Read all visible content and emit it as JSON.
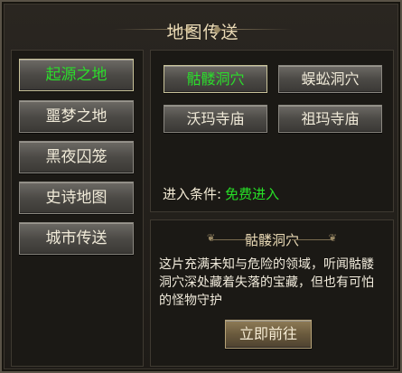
{
  "window": {
    "title": "地图传送"
  },
  "sidebar": {
    "items": [
      {
        "label": "起源之地",
        "active": true
      },
      {
        "label": "噩梦之地",
        "active": false
      },
      {
        "label": "黑夜囚笼",
        "active": false
      },
      {
        "label": "史诗地图",
        "active": false
      },
      {
        "label": "城市传送",
        "active": false
      }
    ]
  },
  "destinations": [
    {
      "label": "骷髅洞穴",
      "selected": true
    },
    {
      "label": "蜈蚣洞穴",
      "selected": false
    },
    {
      "label": "沃玛寺庙",
      "selected": false
    },
    {
      "label": "祖玛寺庙",
      "selected": false
    }
  ],
  "requirement": {
    "label": "进入条件:",
    "value": "免费进入"
  },
  "info": {
    "title": "骷髅洞穴",
    "description": "这片充满未知与危险的领域，听闻骷髅洞穴深处藏着失落的宝藏，但也有可怕的怪物守护",
    "go_label": "立即前往"
  },
  "colors": {
    "active_text": "#2cdc2c",
    "free_text": "#27e027",
    "title_text": "#e9d9b5"
  }
}
